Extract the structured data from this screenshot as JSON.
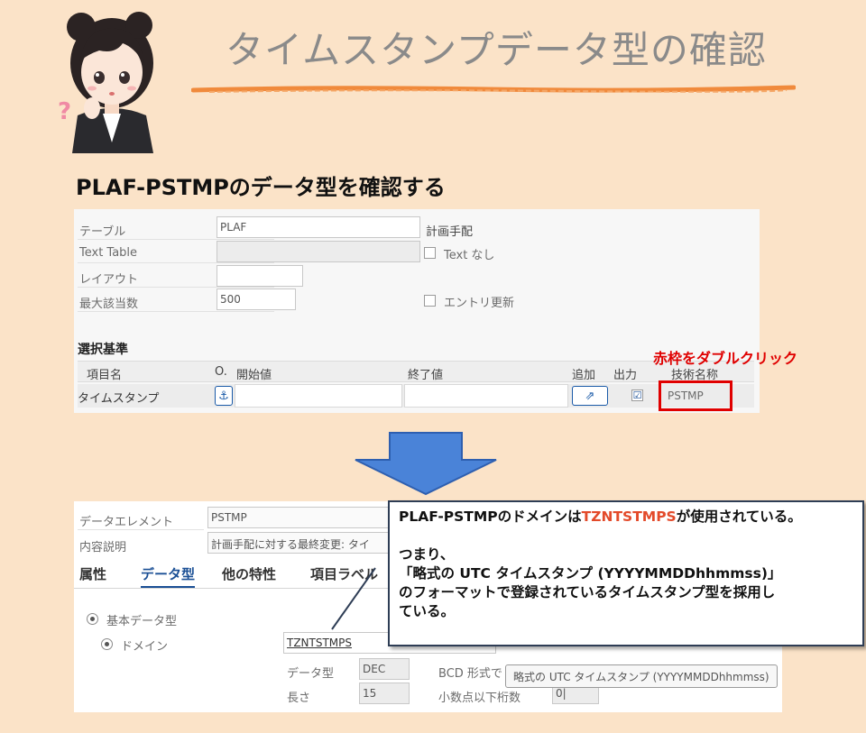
{
  "header": {
    "title": "タイムスタンプデータ型の確認",
    "subtitle": "PLAF-PSTMPのデータ型を確認する"
  },
  "panel1": {
    "fields": {
      "table_label": "テーブル",
      "table_value": "PLAF",
      "table_desc": "計画手配",
      "text_table_label": "Text Table",
      "text_none_label": "Text なし",
      "layout_label": "レイアウト",
      "max_hits_label": "最大該当数",
      "max_hits_value": "500",
      "entry_update_label": "エントリ更新"
    },
    "criteria": {
      "heading": "選択基準",
      "columns": {
        "item_name": "項目名",
        "option": "O.",
        "start_value": "開始値",
        "end_value": "終了値",
        "add": "追加",
        "output": "出力",
        "tech_name": "技術名称"
      },
      "row": {
        "item_name": "タイムスタンプ",
        "output_checked": "☑",
        "tech_name": "PSTMP"
      }
    },
    "note": "赤枠をダブルクリック"
  },
  "panel2": {
    "data_element_label": "データエレメント",
    "data_element_value": "PSTMP",
    "description_label": "内容説明",
    "description_value": "計画手配に対する最終変更: タイ",
    "tabs": [
      "属性",
      "データ型",
      "他の特性",
      "項目ラベル"
    ],
    "basic_type_label": "基本データ型",
    "domain_label": "ドメイン",
    "domain_value": "TZNTSTMPS",
    "data_type_label": "データ型",
    "data_type_value": "DEC",
    "bcd_label": "BCD 形式で",
    "length_label": "長さ",
    "length_value": "15",
    "decimals_label": "小数点以下桁数",
    "decimals_value": "0|",
    "tooltip": "略式の UTC タイムスタンプ (YYYYMMDDhhmmss)"
  },
  "callout": {
    "line1_pre": "PLAF-PSTMPのドメインは",
    "line1_hl": "TZNTSTMPS",
    "line1_post": "が使用されている。",
    "line2": "つまり、",
    "line3": "「略式の UTC タイムスタンプ (YYYYMMDDhhmmss)」",
    "line4": "のフォーマットで登録されているタイムスタンプ型を採用し",
    "line5": "ている。"
  },
  "colors": {
    "background": "#fbe3c8",
    "title_gray": "#8a8a8a",
    "underline_orange": "#f08a3c",
    "highlight_red": "#e00000",
    "arrow_blue": "#4a83d8",
    "sap_blue": "#1a4f95"
  }
}
